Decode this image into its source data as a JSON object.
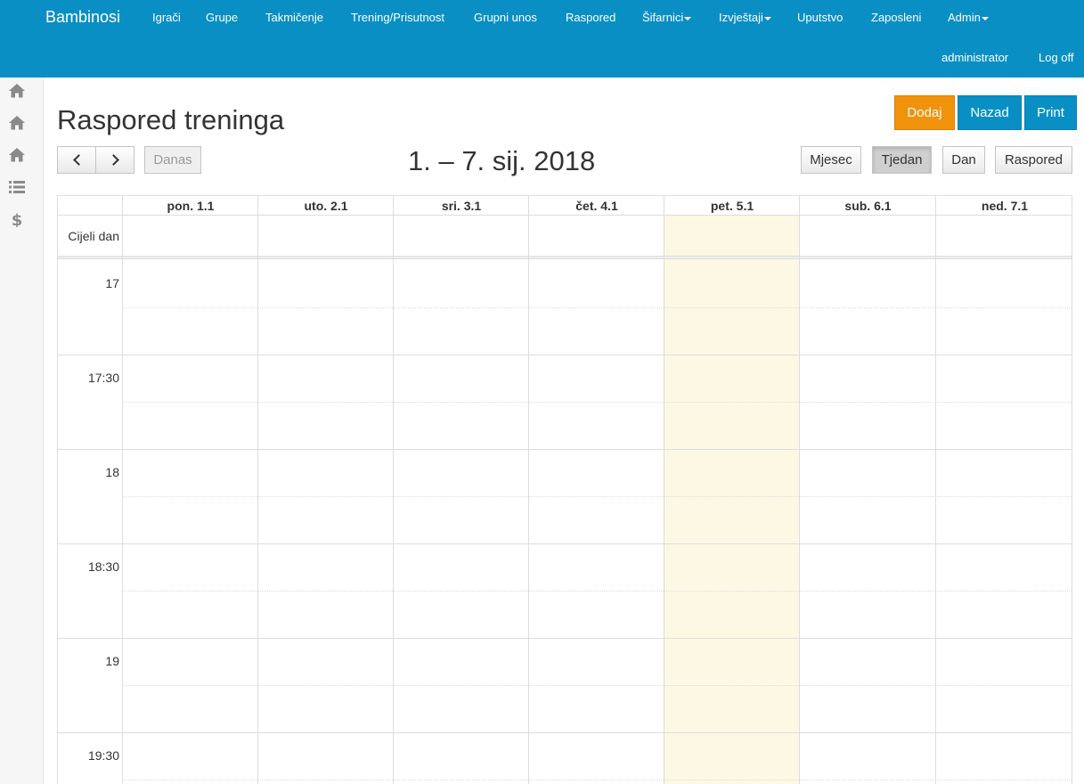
{
  "navbar": {
    "brand": "Bambinosi",
    "items": [
      {
        "label": "Igrači",
        "dropdown": false
      },
      {
        "label": "Grupe",
        "dropdown": false
      },
      {
        "label": "Takmičenje",
        "dropdown": false
      },
      {
        "label": "Trening/Prisutnost",
        "dropdown": false
      },
      {
        "label": "Grupni unos",
        "dropdown": false
      },
      {
        "label": "Raspored",
        "dropdown": false
      },
      {
        "label": "Šifarnici",
        "dropdown": true
      },
      {
        "label": "Izvještaji",
        "dropdown": true
      },
      {
        "label": "Uputstvo",
        "dropdown": false
      },
      {
        "label": "Zaposleni",
        "dropdown": false
      },
      {
        "label": "Admin",
        "dropdown": true
      }
    ],
    "user": "administrator",
    "logoff": "Log off",
    "color": "#0a8fc4"
  },
  "sidebar": {
    "icons": [
      "home-icon",
      "home-icon",
      "home-icon",
      "list-icon",
      "dollar-icon"
    ]
  },
  "page": {
    "title": "Raspored treninga",
    "buttons": {
      "add": "Dodaj",
      "back": "Nazad",
      "print": "Print"
    },
    "add_color": "#f0920b"
  },
  "calendar": {
    "today_label": "Danas",
    "range_title": "1. – 7. sij. 2018",
    "views": {
      "month": "Mjesec",
      "week": "Tjedan",
      "day": "Dan",
      "list": "Raspored"
    },
    "active_view": "Tjedan",
    "days": [
      "pon. 1.1",
      "uto. 2.1",
      "sri. 3.1",
      "čet. 4.1",
      "pet. 5.1",
      "sub. 6.1",
      "ned. 7.1"
    ],
    "today_column": "pet. 5.1",
    "today_color": "#fcf8e3",
    "allday_label": "Cijeli dan",
    "time_slots": [
      "17",
      "17:30",
      "18",
      "18:30",
      "19",
      "19:30"
    ]
  }
}
